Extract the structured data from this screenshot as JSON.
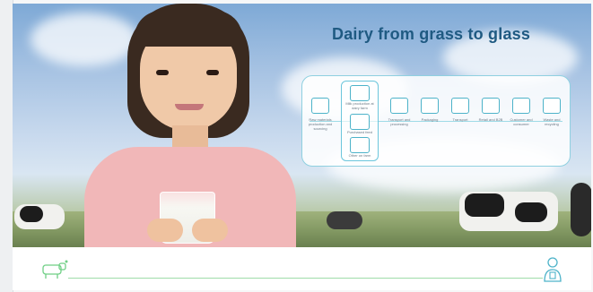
{
  "header": {
    "title": "Dairy from grass to glass"
  },
  "diagram": {
    "stages": [
      "Raw materials production and sourcing",
      "Milk production at dairy farm",
      "Transport and processing",
      "Packaging",
      "Transport",
      "Retail and B2B",
      "Customer and consumer",
      "Waste and recycling"
    ],
    "farm_group": {
      "top_label": "Milk production at dairy farm",
      "middle_label": "Purchased feed",
      "bottom_label": "Other on farm"
    }
  },
  "icons": {
    "footer_left": "cow-icon",
    "footer_right": "person-with-glass-icon"
  },
  "colors": {
    "title": "#1f5a82",
    "accent": "#4db3c9",
    "footer_line": "#9fdca9"
  }
}
